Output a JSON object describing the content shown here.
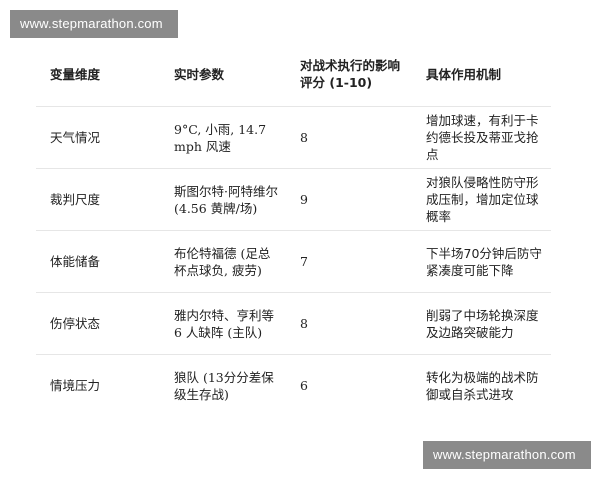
{
  "watermarks": {
    "top": "www.stepmarathon.com",
    "bottom": "www.stepmarathon.com"
  },
  "table": {
    "headers": [
      "变量维度",
      "实时参数",
      "对战术执行的影响评分 (1-10)",
      "具体作用机制"
    ],
    "rows": [
      [
        "天气情况",
        "9°C, 小雨, 14.7 mph 风速",
        "8",
        "增加球速，有利于卡约德长投及蒂亚戈抢点"
      ],
      [
        "裁判尺度",
        "斯图尔特·阿特维尔 (4.56 黄牌/场)",
        "9",
        "对狼队侵略性防守形成压制，增加定位球概率"
      ],
      [
        "体能储备",
        "布伦特福德 (足总杯点球负, 疲劳)",
        "7",
        "下半场70分钟后防守紧凑度可能下降"
      ],
      [
        "伤停状态",
        "雅内尔特、亨利等 6 人缺阵 (主队)",
        "8",
        "削弱了中场轮换深度及边路突破能力"
      ],
      [
        "情境压力",
        "狼队 (13分分差保级生存战)",
        "6",
        "转化为极端的战术防御或自杀式进攻"
      ]
    ]
  }
}
